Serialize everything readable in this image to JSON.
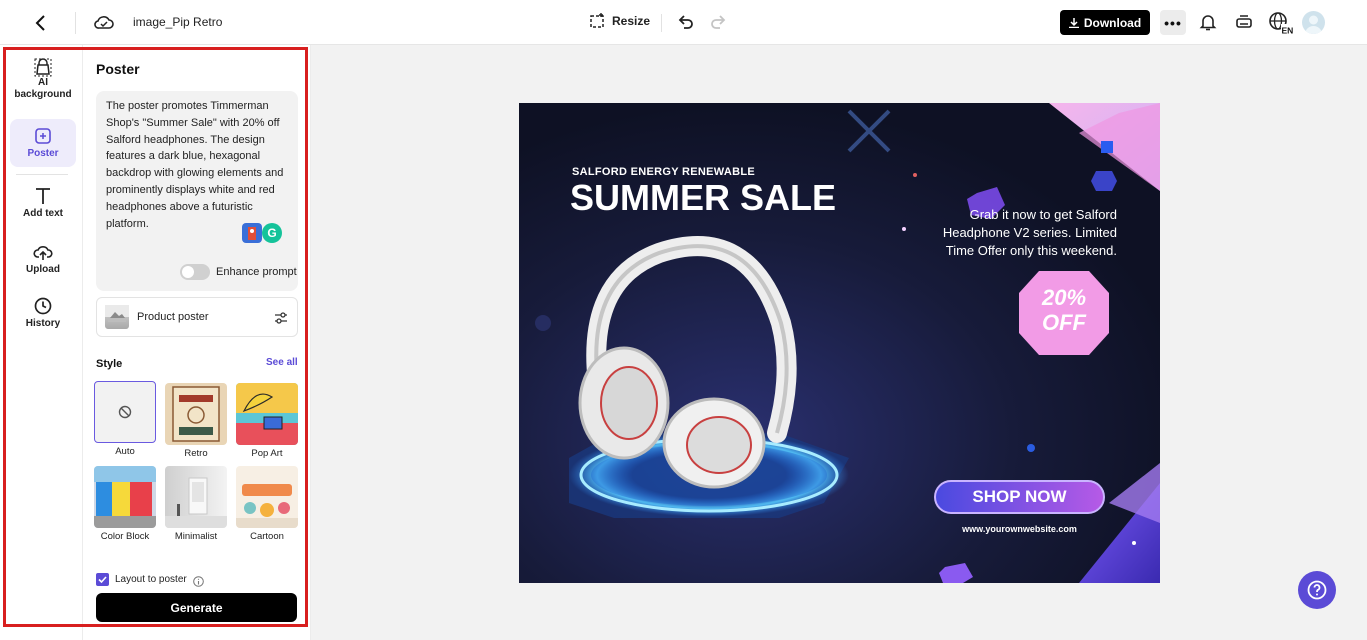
{
  "topbar": {
    "file_name": "image_Pip Retro",
    "resize_label": "Resize",
    "download_label": "Download",
    "more_label": "•••",
    "lang_code": "EN"
  },
  "rail": {
    "items": [
      {
        "label": "AI background",
        "icon": "ai-bag-icon"
      },
      {
        "label": "Poster",
        "icon": "poster-icon"
      },
      {
        "label": "Add text",
        "icon": "text-icon"
      },
      {
        "label": "Upload",
        "icon": "upload-cloud-icon"
      },
      {
        "label": "History",
        "icon": "clock-icon"
      }
    ]
  },
  "panel": {
    "title": "Poster",
    "prompt": "The poster promotes Timmerman Shop's \"Summer Sale\" with 20% off Salford headphones. The design features a dark blue, hexagonal backdrop with glowing elements and prominently displays white and red headphones above a futuristic platform.",
    "enhance_label": "Enhance prompt",
    "product_type": "Product poster",
    "style_label": "Style",
    "see_all": "See all",
    "styles": [
      {
        "name": "Auto"
      },
      {
        "name": "Retro"
      },
      {
        "name": "Pop Art"
      },
      {
        "name": "Color Block"
      },
      {
        "name": "Minimalist"
      },
      {
        "name": "Cartoon"
      }
    ],
    "layout_label": "Layout to poster",
    "generate_label": "Generate"
  },
  "poster": {
    "kicker": "SALFORD ENERGY RENEWABLE",
    "headline": "SUMMER SALE",
    "offer_line1": "Grab it now to get Salford",
    "offer_line2": "Headphone V2 series. Limited",
    "offer_line3": "Time Offer only this weekend.",
    "badge_line1": "20%",
    "badge_line2": "OFF",
    "cta": "SHOP NOW",
    "website": "www.yourownwebsite.com"
  },
  "colors": {
    "accent": "#5b4bd6",
    "highlight": "#d81f1f",
    "poster_bg": "#141830",
    "badge": "#f29be6"
  }
}
